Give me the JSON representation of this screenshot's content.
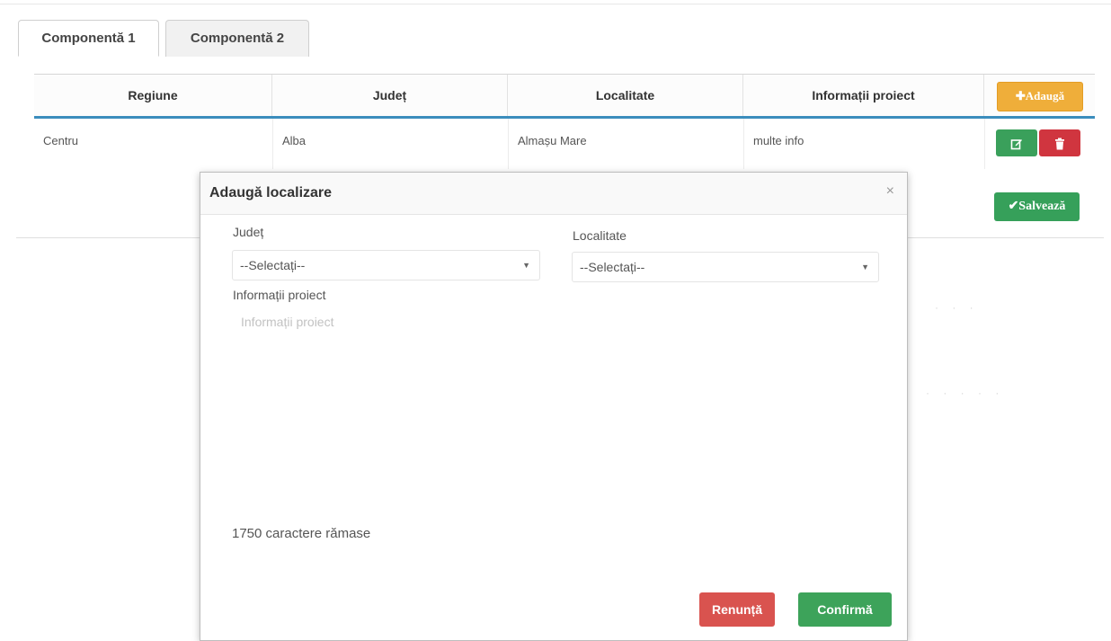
{
  "tabs": [
    {
      "label": "Componentă 1",
      "active": true
    },
    {
      "label": "Componentă 2",
      "active": false
    }
  ],
  "table": {
    "headers": [
      "Regiune",
      "Județ",
      "Localitate",
      "Informații proiect"
    ],
    "add_button": "✚Adaugă",
    "rows": [
      {
        "regiune": "Centru",
        "judet": "Alba",
        "localitate": "Almașu Mare",
        "info": "multe info"
      }
    ],
    "edit_icon": "edit-icon",
    "delete_icon": "trash-icon"
  },
  "save_button": "✔Salvează",
  "modal": {
    "title": "Adaugă localizare",
    "close": "×",
    "judet_label": "Județ",
    "judet_value": "--Selectați--",
    "localitate_label": "Localitate",
    "localitate_value": "--Selectați--",
    "info_label": "Informații proiect",
    "info_placeholder": "Informații proiect",
    "counter": "1750 caractere rămase",
    "cancel": "Renunță",
    "confirm": "Confirmă"
  },
  "colors": {
    "accent_blue": "#3b8dbd",
    "add_orange": "#efae3a",
    "success_green": "#3da35a",
    "danger_red": "#d9534f"
  }
}
